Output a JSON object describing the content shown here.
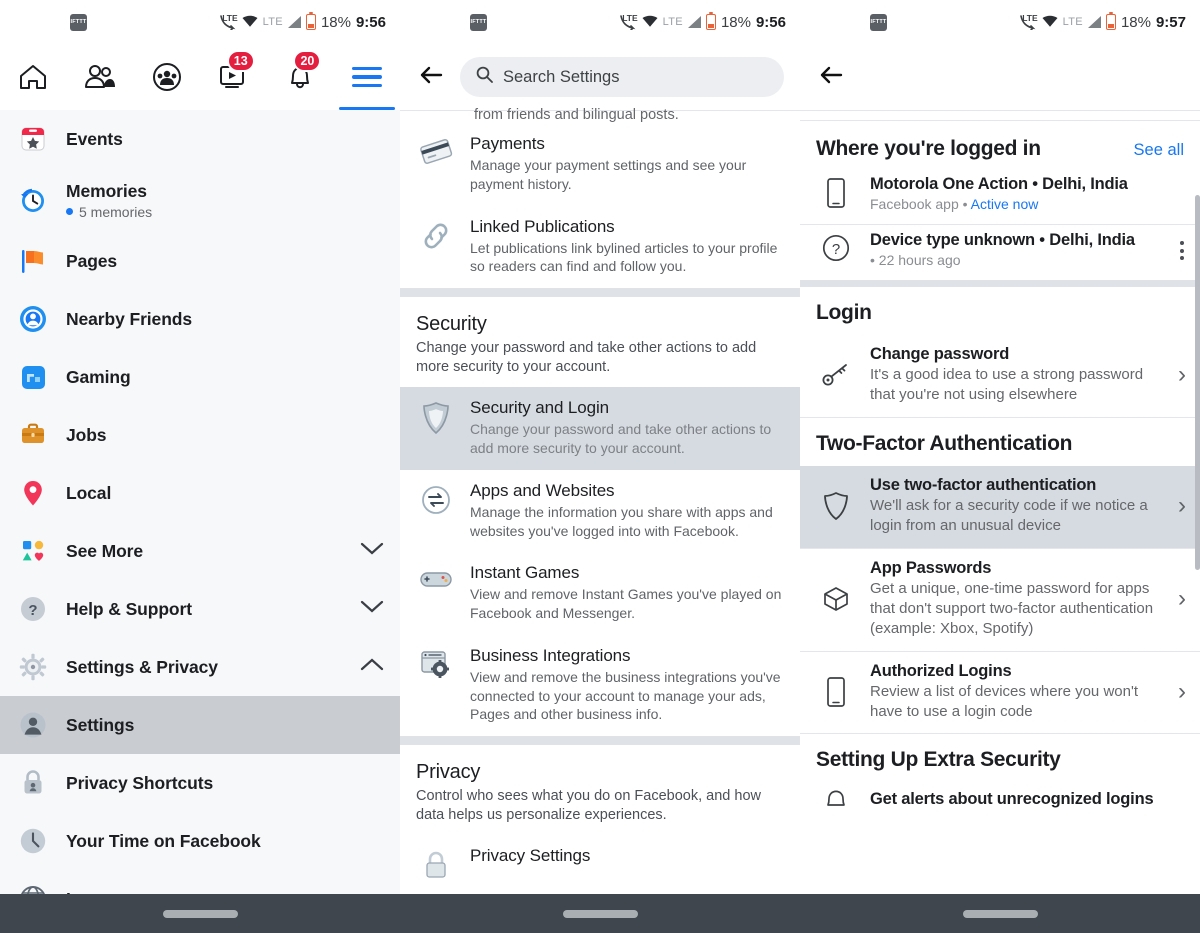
{
  "statusbars": [
    {
      "notif_icon": "ifttt-icon",
      "lte_label": "LTE",
      "lte_label2": "LTE",
      "battery_pct": "18%",
      "time": "9:56"
    },
    {
      "notif_icon": "ifttt-icon",
      "lte_label": "LTE",
      "lte_label2": "LTE",
      "battery_pct": "18%",
      "time": "9:56"
    },
    {
      "notif_icon": "ifttt-icon",
      "lte_label": "LTE",
      "lte_label2": "LTE",
      "battery_pct": "18%",
      "time": "9:57"
    }
  ],
  "left": {
    "topnav": {
      "tabs": [
        {
          "name": "home-tab",
          "icon": "home-icon",
          "badge": ""
        },
        {
          "name": "friends-tab",
          "icon": "friends-icon",
          "badge": ""
        },
        {
          "name": "groups-tab",
          "icon": "groups-icon",
          "badge": ""
        },
        {
          "name": "watch-tab",
          "icon": "watch-icon",
          "badge": "13"
        },
        {
          "name": "notifications-tab",
          "icon": "bell-icon",
          "badge": "20"
        },
        {
          "name": "menu-tab",
          "icon": "hamburger-icon",
          "badge": ""
        }
      ]
    },
    "menu": [
      {
        "label": "Events",
        "icon": "events-icon",
        "sub": "",
        "chevron": "",
        "selected": false
      },
      {
        "label": "Memories",
        "icon": "memories-icon",
        "sub": "5 memories",
        "chevron": "",
        "selected": false
      },
      {
        "label": "Pages",
        "icon": "pages-icon",
        "sub": "",
        "chevron": "",
        "selected": false
      },
      {
        "label": "Nearby Friends",
        "icon": "nearby-friends-icon",
        "sub": "",
        "chevron": "",
        "selected": false
      },
      {
        "label": "Gaming",
        "icon": "gaming-icon",
        "sub": "",
        "chevron": "",
        "selected": false
      },
      {
        "label": "Jobs",
        "icon": "jobs-icon",
        "sub": "",
        "chevron": "",
        "selected": false
      },
      {
        "label": "Local",
        "icon": "local-icon",
        "sub": "",
        "chevron": "",
        "selected": false
      },
      {
        "label": "See More",
        "icon": "see-more-icon",
        "sub": "",
        "chevron": "down",
        "selected": false
      },
      {
        "label": "Help & Support",
        "icon": "help-icon",
        "sub": "",
        "chevron": "down",
        "selected": false
      },
      {
        "label": "Settings & Privacy",
        "icon": "settings-privacy-icon",
        "sub": "",
        "chevron": "up",
        "selected": false
      },
      {
        "label": "Settings",
        "icon": "account-icon",
        "sub": "",
        "chevron": "",
        "selected": true
      },
      {
        "label": "Privacy Shortcuts",
        "icon": "privacy-lock-icon",
        "sub": "",
        "chevron": "",
        "selected": false
      },
      {
        "label": "Your Time on Facebook",
        "icon": "clock-icon",
        "sub": "",
        "chevron": "",
        "selected": false
      },
      {
        "label": "Language",
        "icon": "globe-icon",
        "sub": "",
        "chevron": "",
        "selected": false
      }
    ]
  },
  "mid": {
    "back_label": "back-arrow",
    "search": {
      "placeholder": "Search Settings",
      "icon": "search-icon"
    },
    "cut_text": "from friends and bilingual posts.",
    "rows_top": [
      {
        "title": "Payments",
        "desc": "Manage your payment settings and see your payment history.",
        "icon": "credit-card-icon",
        "highlighted": false
      },
      {
        "title": "Linked Publications",
        "desc": "Let publications link bylined articles to your profile so readers can find and follow you.",
        "icon": "link-icon",
        "highlighted": false
      }
    ],
    "security_section": {
      "title": "Security",
      "desc": "Change your password and take other actions to add more security to your account.",
      "rows": [
        {
          "title": "Security and Login",
          "desc": "Change your password and take other actions to add more security to your account.",
          "icon": "shield-icon",
          "highlighted": true
        },
        {
          "title": "Apps and Websites",
          "desc": "Manage the information you share with apps and websites you've logged into with Facebook.",
          "icon": "exchange-arrows-icon",
          "highlighted": false
        },
        {
          "title": "Instant Games",
          "desc": "View and remove Instant Games you've played on Facebook and Messenger.",
          "icon": "gamepad-icon",
          "highlighted": false
        },
        {
          "title": "Business Integrations",
          "desc": "View and remove the business integrations you've connected to your account to manage your ads, Pages and other business info.",
          "icon": "browser-gear-icon",
          "highlighted": false
        }
      ]
    },
    "privacy_section": {
      "title": "Privacy",
      "desc": "Control who sees what you do on Facebook, and how data helps us personalize experiences.",
      "rows": [
        {
          "title": "Privacy Settings",
          "desc": "",
          "icon": "padlock-icon",
          "highlighted": false
        }
      ]
    }
  },
  "right": {
    "back_label": "back-arrow",
    "logged_in": {
      "title": "Where you're logged in",
      "see_all": "See all",
      "devices": [
        {
          "title": "Motorola One Action • Delhi, India",
          "sub_prefix": "Facebook app • ",
          "sub_active": "Active now",
          "icon": "phone-icon",
          "kebab": false
        },
        {
          "title": "Device type unknown • Delhi, India",
          "sub_prefix": "• 22 hours ago",
          "sub_active": "",
          "icon": "question-circle-icon",
          "kebab": true
        }
      ]
    },
    "login": {
      "title": "Login",
      "rows": [
        {
          "title": "Change password",
          "desc": "It's a good idea to use a strong password that you're not using elsewhere",
          "icon": "key-icon",
          "chevron": "›",
          "highlighted": false
        }
      ]
    },
    "two_factor": {
      "title": "Two-Factor Authentication",
      "rows": [
        {
          "title": "Use two-factor authentication",
          "desc": "We'll ask for a security code if we notice a login from an unusual device",
          "icon": "shield-outline-icon",
          "chevron": "›",
          "highlighted": true
        },
        {
          "title": "App Passwords",
          "desc": "Get a unique, one-time password for apps that don't support two-factor authentication (example: Xbox, Spotify)",
          "icon": "cube-icon",
          "chevron": "›",
          "highlighted": false
        },
        {
          "title": "Authorized Logins",
          "desc": "Review a list of devices where you won't have to use a login code",
          "icon": "mobile-icon",
          "chevron": "›",
          "highlighted": false
        }
      ]
    },
    "extra_security": {
      "title": "Setting Up Extra Security",
      "rows": [
        {
          "title": "Get alerts about unrecognized logins",
          "desc": "",
          "icon": "bell-outline-icon",
          "chevron": "",
          "highlighted": false
        }
      ]
    }
  },
  "colors": {
    "accent": "#1877f2",
    "badge": "#e41e3f",
    "highlight": "#d6dbe1",
    "navbar": "#3f464d"
  }
}
